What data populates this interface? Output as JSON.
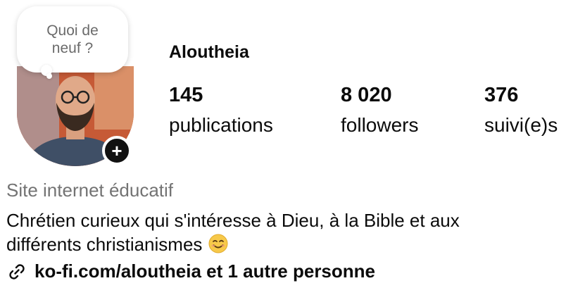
{
  "profile": {
    "username": "Aloutheia",
    "note_placeholder_line1": "Quoi de",
    "note_placeholder_line2": "neuf ?",
    "add_icon": "plus-icon"
  },
  "stats": {
    "posts_value": "145",
    "posts_label": "publications",
    "followers_value": "8 020",
    "followers_label": "followers",
    "following_value": "376",
    "following_label": "suivi(e)s"
  },
  "bio": {
    "category": "Site internet éducatif",
    "text_line1": "Chrétien curieux qui s'intéresse à Dieu, à la Bible et aux",
    "text_line2": "différents christianismes",
    "emoji_icon": "smiling-face-icon",
    "link_icon": "link-icon",
    "link_text": "ko-fi.com/aloutheia et 1 autre personne"
  },
  "colors": {
    "text_primary": "#0b0b0b",
    "text_secondary": "#737373",
    "note_text": "#6b6b6b",
    "add_button_bg": "#111111"
  }
}
